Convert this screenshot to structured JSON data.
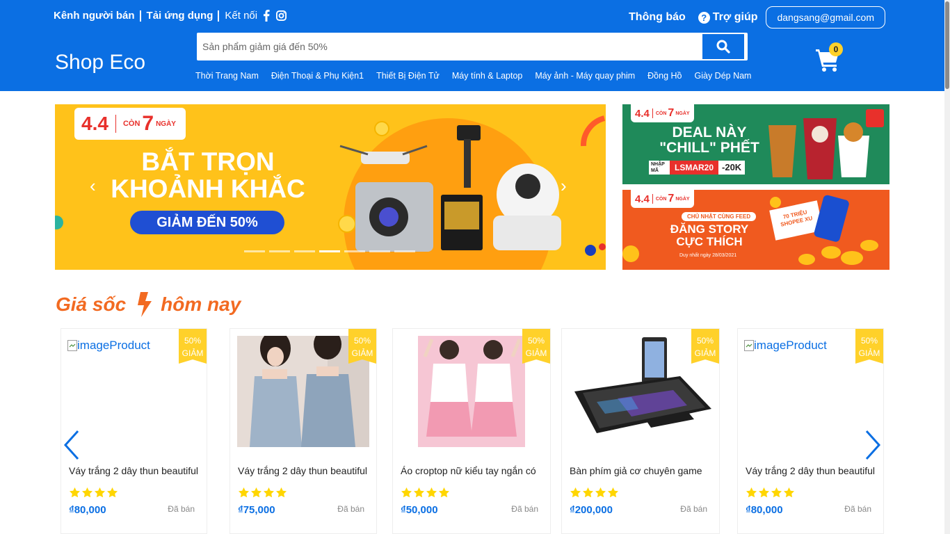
{
  "header": {
    "seller_channel": "Kênh người bán",
    "download_app": "Tải ứng dụng",
    "connect": "Kết nối",
    "notifications": "Thông báo",
    "help": "Trợ giúp",
    "user_email": "dangsang@gmail.com",
    "logo": "Shop Eco",
    "search_placeholder": "Sản phẩm giảm giá đến 50%",
    "cart_count": "0",
    "categories": [
      "Thời Trang Nam",
      "Điện Thoại & Phụ Kiện1",
      "Thiết Bị Điện Tử",
      "Máy tính & Laptop",
      "Máy ảnh - Máy quay phim",
      "Đồng Hồ",
      "Giày Dép Nam"
    ]
  },
  "banners": {
    "main": {
      "sale_date": "4.4",
      "countdown_label": "CÒN",
      "countdown_value": "7",
      "countdown_unit": "NGÀY",
      "headline_1": "BẮT TRỌN",
      "headline_2": "KHOẢNH KHẮC",
      "pill": "GIẢM ĐẾN 50%",
      "slide_count": 7,
      "active_slide": 4
    },
    "side_1": {
      "sale_date": "4.4",
      "countdown_label": "CÒN",
      "countdown_value": "7",
      "countdown_unit": "NGÀY",
      "headline_1": "DEAL NÀY",
      "headline_2": "\"CHILL\" PHẾT",
      "code_label": "NHẬP MÃ",
      "code": "LSMAR20",
      "discount": "-20K"
    },
    "side_2": {
      "sale_date": "4.4",
      "countdown_label": "CÒN",
      "countdown_value": "7",
      "countdown_unit": "NGÀY",
      "tagline": "CHỦ NHẬT CÙNG FEED",
      "headline_1": "ĐĂNG STORY",
      "headline_2": "CỰC THÍCH",
      "note": "Duy nhất ngày 28/03/2021",
      "coins_1": "70 TRIỆU",
      "coins_2": "SHOPEE XU"
    }
  },
  "flash_sale": {
    "title_1": "Giá sốc",
    "title_2": "hôm nay",
    "products": [
      {
        "alt": "imageProduct",
        "name": "Váy trắng 2 dây thun beautiful",
        "price": "₫80,000",
        "sold_label": "Đã bán",
        "sale_pct": "50%",
        "sale_label": "GIẢM",
        "rating": 4,
        "image": "missing"
      },
      {
        "alt": "imageProduct",
        "name": "Váy trắng 2 dây thun beautiful",
        "price": "₫75,000",
        "sold_label": "Đã bán",
        "sale_pct": "50%",
        "sale_label": "GIẢM",
        "rating": 4,
        "image": "dress-photo"
      },
      {
        "alt": "imageProduct",
        "name": "Áo croptop nữ kiểu tay ngắn có",
        "price": "₫50,000",
        "sold_label": "Đã bán",
        "sale_pct": "50%",
        "sale_label": "GIẢM",
        "rating": 4,
        "image": "croptop-photo"
      },
      {
        "alt": "imageProduct",
        "name": "Bàn phím giả cơ chuyên game",
        "price": "₫200,000",
        "sold_label": "Đã bán",
        "sale_pct": "50%",
        "sale_label": "GIẢM",
        "rating": 4,
        "image": "keyboard-photo"
      },
      {
        "alt": "imageProduct",
        "name": "Váy trắng 2 dây thun beautiful",
        "price": "₫80,000",
        "sold_label": "Đã bán",
        "sale_pct": "50%",
        "sale_label": "GIẢM",
        "rating": 4,
        "image": "missing"
      }
    ]
  },
  "colors": {
    "primary": "#0b6fe3",
    "accent": "#f26a21",
    "star": "#ffd600",
    "sale_tag": "#ffd12a"
  }
}
